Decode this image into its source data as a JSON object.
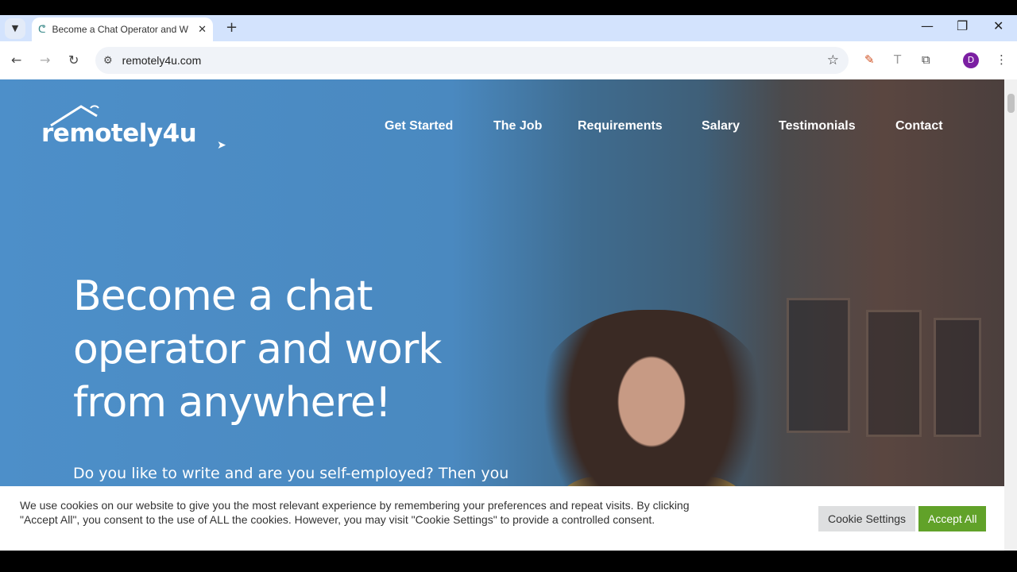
{
  "browser": {
    "tab_title": "Become a Chat Operator and W",
    "url": "remotely4u.com",
    "profile_initial": "D",
    "new_tab": "+",
    "close_tab": "✕"
  },
  "site": {
    "logo": "remotely4u",
    "nav": [
      "Get Started",
      "The Job",
      "Requirements",
      "Salary",
      "Testimonials",
      "Contact"
    ],
    "hero_lines": [
      "Become a chat",
      "operator and work",
      "from anywhere!"
    ],
    "hero_sub": "Do you like to write and are you self-employed? Then you"
  },
  "cookie": {
    "text": "We use cookies on our website to give you the most relevant experience by remembering your preferences and repeat visits. By clicking \"Accept All\", you consent to the use of ALL the cookies. However, you may visit \"Cookie Settings\" to provide a controlled consent.",
    "settings_label": "Cookie Settings",
    "accept_label": "Accept All"
  },
  "colors": {
    "accent_green": "#61a229",
    "hero_blue": "#4d8fc9",
    "avatar": "#7b1fa2"
  }
}
